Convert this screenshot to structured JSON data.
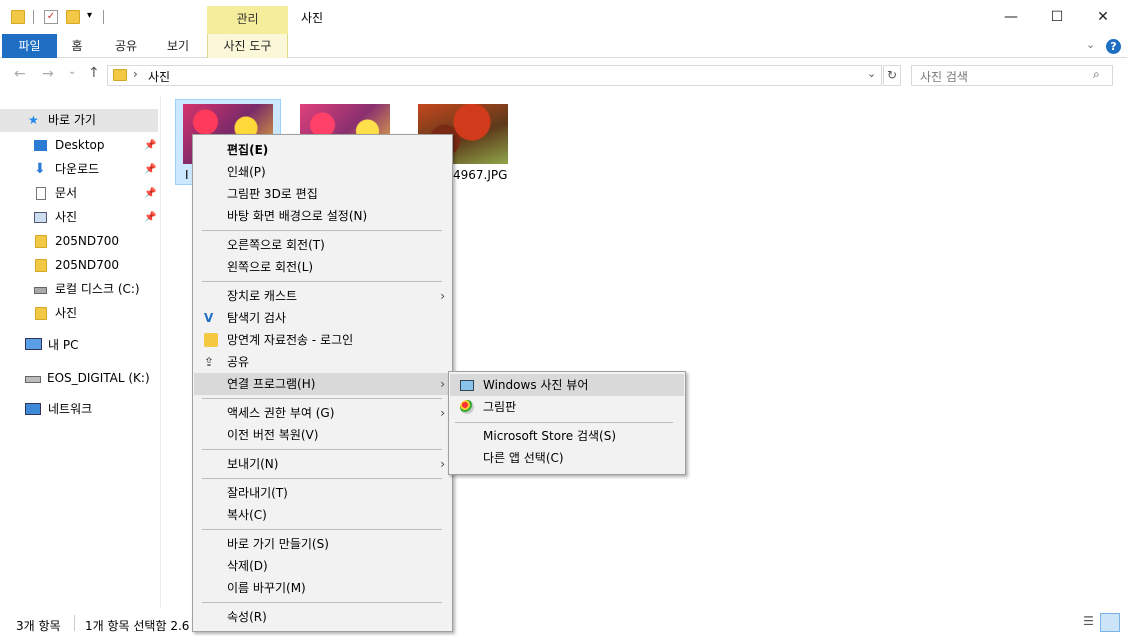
{
  "window": {
    "title": "사진",
    "context_tab": "관리",
    "minimize": "—",
    "maximize": "☐",
    "close": "✕"
  },
  "ribbon": {
    "tabs": [
      "파일",
      "홈",
      "공유",
      "보기",
      "사진 도구"
    ],
    "help": "?"
  },
  "address": {
    "path": "사진",
    "search_placeholder": "사진 검색"
  },
  "nav_pane": {
    "quick_access": "바로 가기",
    "items": [
      {
        "label": "Desktop",
        "icon": "desktop-icon",
        "pinned": true
      },
      {
        "label": "다운로드",
        "icon": "download-icon",
        "pinned": true
      },
      {
        "label": "문서",
        "icon": "document-icon",
        "pinned": true
      },
      {
        "label": "사진",
        "icon": "pictures-icon",
        "pinned": true
      },
      {
        "label": "205ND700",
        "icon": "folder-icon",
        "pinned": false
      },
      {
        "label": "205ND700",
        "icon": "folder-icon",
        "pinned": false
      },
      {
        "label": "로컬 디스크 (C:)",
        "icon": "drive-icon",
        "pinned": false
      },
      {
        "label": "사진",
        "icon": "folder-icon",
        "pinned": false
      }
    ],
    "this_pc": "내 PC",
    "eos": "EOS_DIGITAL (K:)",
    "network": "네트워크"
  },
  "files": {
    "partial_label_1": "I",
    "partial_label_3": "4967.JPG"
  },
  "status": {
    "count": "3개 항목",
    "selection": "1개 항목 선택함 2.6"
  },
  "context_menu": {
    "items": {
      "edit": "편집(E)",
      "print": "인쇄(P)",
      "paint3d": "그림판 3D로 편집",
      "wallpaper": "바탕 화면 배경으로 설정(N)",
      "rotate_right": "오른쪽으로 회전(T)",
      "rotate_left": "왼쪽으로 회전(L)",
      "cast": "장치로 캐스트",
      "scan": "탐색기 검사",
      "netlink": "망연계 자료전송 - 로그인",
      "share": "공유",
      "open_with": "연결 프로그램(H)",
      "access": "액세스 권한 부여 (G)",
      "restore": "이전 버전 복원(V)",
      "send_to": "보내기(N)",
      "cut": "잘라내기(T)",
      "copy": "복사(C)",
      "shortcut": "바로 가기 만들기(S)",
      "delete": "삭제(D)",
      "rename": "이름 바꾸기(M)",
      "properties": "속성(R)"
    }
  },
  "submenu": {
    "viewer": "Windows 사진 뷰어",
    "paint": "그림판",
    "store": "Microsoft Store 검색(S)",
    "other": "다른 앱 선택(C)"
  }
}
